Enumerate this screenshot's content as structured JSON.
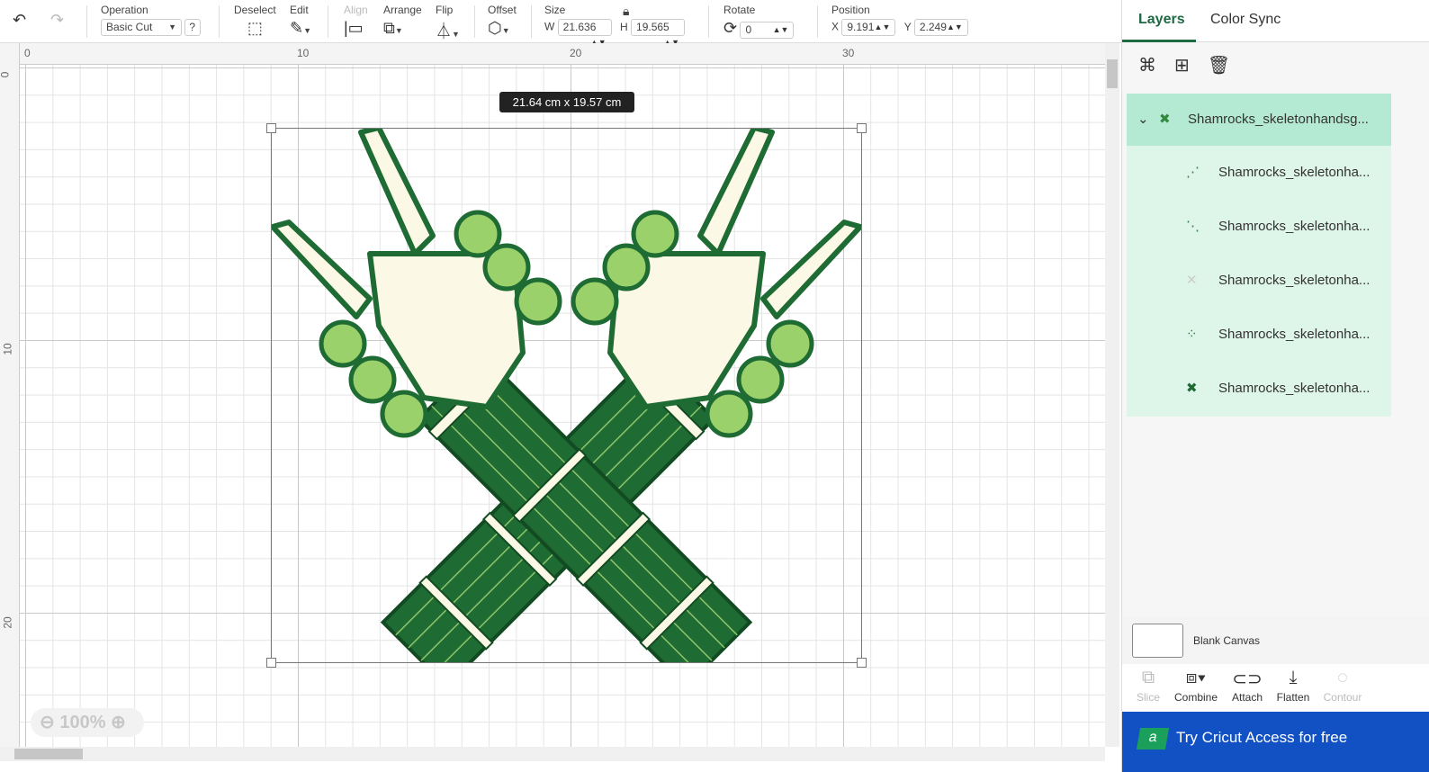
{
  "toolbar": {
    "operation_label": "Operation",
    "operation_value": "Basic Cut",
    "help": "?",
    "deselect": "Deselect",
    "edit": "Edit",
    "align": "Align",
    "arrange": "Arrange",
    "flip": "Flip",
    "offset": "Offset",
    "size": "Size",
    "w_label": "W",
    "w_value": "21.636",
    "h_label": "H",
    "h_value": "19.565",
    "rotate": "Rotate",
    "rotate_value": "0",
    "position": "Position",
    "x_label": "X",
    "x_value": "9.191",
    "y_label": "Y",
    "y_value": "2.249"
  },
  "rulers": {
    "top": [
      "0",
      "10",
      "20",
      "30"
    ],
    "left": [
      "0",
      "10",
      "20"
    ]
  },
  "canvas": {
    "size_tip": "21.64  cm x 19.57  cm",
    "zoom": "100%"
  },
  "panel": {
    "tabs": [
      "Layers",
      "Color Sync"
    ],
    "group": "Shamrocks_skeletonhandsg...",
    "children": [
      "Shamrocks_skeletonha...",
      "Shamrocks_skeletonha...",
      "Shamrocks_skeletonha...",
      "Shamrocks_skeletonha...",
      "Shamrocks_skeletonha..."
    ],
    "blank_canvas": "Blank Canvas",
    "actions": [
      "Slice",
      "Combine",
      "Attach",
      "Flatten",
      "Contour"
    ],
    "promo": "Try Cricut Access for free",
    "promo_logo": "a"
  },
  "colors": {
    "accent": "#1f6a43",
    "dark_green": "#1e6b33",
    "mid_green": "#2f8a3f",
    "light_green": "#9bd16a",
    "bone": "#fbf8e6",
    "promo": "#1251c4"
  }
}
